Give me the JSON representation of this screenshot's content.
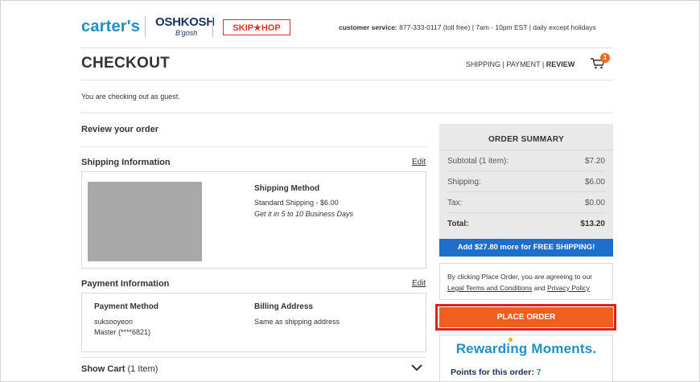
{
  "header": {
    "brands": {
      "carters": "carter's",
      "oshkosh": "OSHKOSH",
      "oshkosh_sub": "B'gosh",
      "skiphop": "SKIP★HOP"
    },
    "customer_service_label": "customer service:",
    "customer_service_text": "877-333-0117 (toll free) | 7am - 10pm EST | daily except holidays"
  },
  "page": {
    "title": "CHECKOUT",
    "steps": {
      "shipping": "SHIPPING",
      "sep": "|",
      "payment": "PAYMENT",
      "review": "REVIEW"
    },
    "cart_count": "1",
    "guest_note": "You are checking out as guest."
  },
  "review": {
    "heading": "Review your order",
    "shipping": {
      "title": "Shipping Information",
      "edit": "Edit",
      "method_label": "Shipping Method",
      "method_value": "Standard Shipping - $6.00",
      "delivery_note": "Get it in 5 to 10 Business Days"
    },
    "payment": {
      "title": "Payment Information",
      "edit": "Edit",
      "method_label": "Payment Method",
      "name": "suksooyeon",
      "card": "Master (****6821)",
      "billing_label": "Billing Address",
      "billing_value": "Same as shipping address"
    },
    "show_cart": {
      "label": "Show Cart",
      "count": "(1 Item)"
    }
  },
  "summary": {
    "title": "ORDER SUMMARY",
    "rows": [
      {
        "label": "Subtotal (1 item):",
        "value": "$7.20"
      },
      {
        "label": "Shipping:",
        "value": "$6.00"
      },
      {
        "label": "Tax:",
        "value": "$0.00"
      }
    ],
    "total_label": "Total:",
    "total_value": "$13.20",
    "free_shipping_banner": "Add $27.80 more for FREE SHIPPING!",
    "terms_prefix": "By clicking Place Order, you are agreeing to our",
    "terms_link": "Legal Terms and Conditions",
    "terms_and": "and",
    "privacy_link": "Privacy Policy",
    "place_order": "PLACE ORDER"
  },
  "rewards": {
    "logo": "Rewarding Moments.",
    "points_label": "Points for this order:",
    "points_value": "7"
  },
  "colors": {
    "accent_blue": "#1f8fc9",
    "banner_blue": "#1d6fce",
    "orange": "#f25e1e",
    "red_outline": "#e02020"
  },
  "icons": [
    "cart-icon",
    "chevron-down-icon"
  ]
}
